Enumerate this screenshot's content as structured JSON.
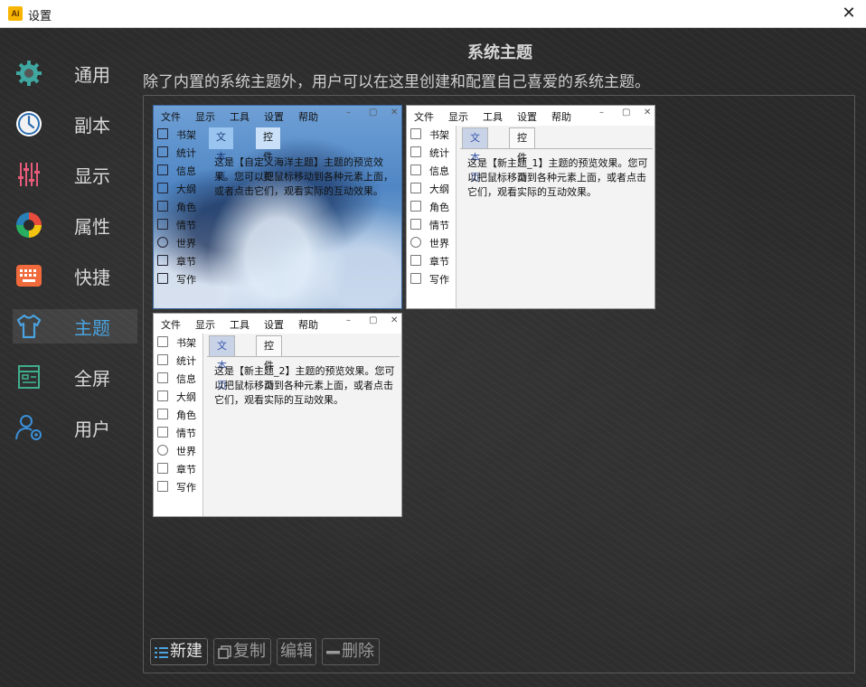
{
  "window": {
    "title": "设置",
    "app_icon": "Ai",
    "close_glyph": "✕"
  },
  "sidebar": {
    "items": [
      {
        "label": "通用",
        "icon": "gear-icon"
      },
      {
        "label": "副本",
        "icon": "clock-icon"
      },
      {
        "label": "显示",
        "icon": "sliders-icon"
      },
      {
        "label": "属性",
        "icon": "palette-icon"
      },
      {
        "label": "快捷",
        "icon": "keyboard-icon"
      },
      {
        "label": "主题",
        "icon": "tshirt-icon",
        "active": true
      },
      {
        "label": "全屏",
        "icon": "fullscreen-icon"
      },
      {
        "label": "用户",
        "icon": "user-settings-icon"
      }
    ]
  },
  "main": {
    "title": "系统主题",
    "description": "除了内置的系统主题外，用户可以在这里创建和配置自己喜爱的系统主题。"
  },
  "preview_common": {
    "menu": [
      "文件",
      "显示",
      "工具",
      "设置",
      "帮助"
    ],
    "window_controls": [
      "–",
      "▢",
      "✕"
    ],
    "tree": [
      "书架",
      "统计",
      "信息",
      "大纲",
      "角色",
      "情节",
      "世界",
      "章节",
      "写作"
    ],
    "tabs": [
      "文本页",
      "控件页"
    ]
  },
  "previews": [
    {
      "text": "这是【自定义海洋主题】主题的预览效果。您可以把鼠标移动到各种元素上面，或者点击它们，观看实际的互动效果。"
    },
    {
      "text": "这是【新主题_1】主题的预览效果。您可以把鼠标移动到各种元素上面，或者点击它们，观看实际的互动效果。"
    },
    {
      "text": "这是【新主题_2】主题的预览效果。您可以把鼠标移动到各种元素上面，或者点击它们，观看实际的互动效果。"
    }
  ],
  "actions": {
    "new": "新建",
    "copy": "复制",
    "edit": "编辑",
    "delete": "删除"
  },
  "colors": {
    "accent": "#4aa3e0",
    "board": "#2a2a2a"
  }
}
